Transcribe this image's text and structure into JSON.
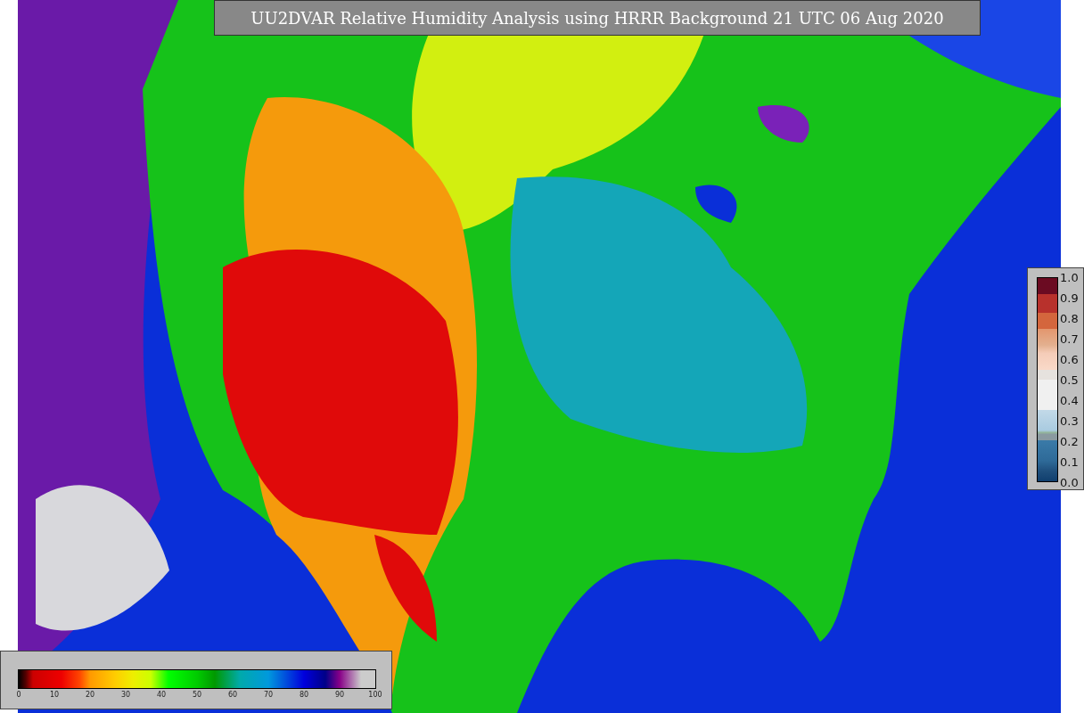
{
  "title": "UU2DVAR Relative Humidity Analysis using HRRR Background 21 UTC 06 Aug 2020",
  "humidity_scale": {
    "ticks": [
      "0",
      "10",
      "20",
      "30",
      "40",
      "50",
      "60",
      "70",
      "80",
      "90",
      "100"
    ]
  },
  "ratio_scale": {
    "ticks": [
      "1.0",
      "0.9",
      "0.8",
      "0.7",
      "0.6",
      "0.5",
      "0.4",
      "0.3",
      "0.2",
      "0.1",
      "0.0"
    ]
  }
}
